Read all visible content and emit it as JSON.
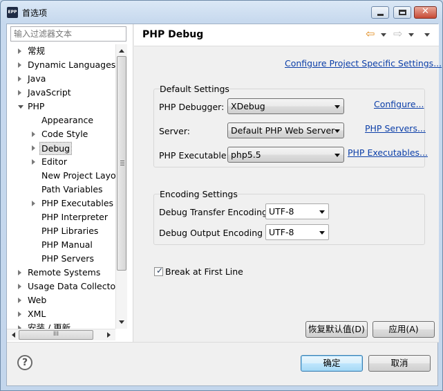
{
  "window": {
    "icon_text": "EPP",
    "title": "首选项"
  },
  "filter": {
    "placeholder": "输入过滤器文本"
  },
  "tree": [
    {
      "label": "常规",
      "level": 0,
      "twisty": "closed"
    },
    {
      "label": "Dynamic Languages",
      "level": 0,
      "twisty": "closed"
    },
    {
      "label": "Java",
      "level": 0,
      "twisty": "closed"
    },
    {
      "label": "JavaScript",
      "level": 0,
      "twisty": "closed"
    },
    {
      "label": "PHP",
      "level": 0,
      "twisty": "open"
    },
    {
      "label": "Appearance",
      "level": 1,
      "twisty": "none"
    },
    {
      "label": "Code Style",
      "level": 1,
      "twisty": "closed"
    },
    {
      "label": "Debug",
      "level": 1,
      "twisty": "closed",
      "selected": true
    },
    {
      "label": "Editor",
      "level": 1,
      "twisty": "closed"
    },
    {
      "label": "New Project Layou",
      "level": 1,
      "twisty": "none"
    },
    {
      "label": "Path Variables",
      "level": 1,
      "twisty": "none"
    },
    {
      "label": "PHP Executables",
      "level": 1,
      "twisty": "closed"
    },
    {
      "label": "PHP Interpreter",
      "level": 1,
      "twisty": "none"
    },
    {
      "label": "PHP Libraries",
      "level": 1,
      "twisty": "none"
    },
    {
      "label": "PHP Manual",
      "level": 1,
      "twisty": "none"
    },
    {
      "label": "PHP Servers",
      "level": 1,
      "twisty": "none"
    },
    {
      "label": "Remote Systems",
      "level": 0,
      "twisty": "closed"
    },
    {
      "label": "Usage Data Collector",
      "level": 0,
      "twisty": "closed"
    },
    {
      "label": "Web",
      "level": 0,
      "twisty": "closed"
    },
    {
      "label": "XML",
      "level": 0,
      "twisty": "closed"
    },
    {
      "label": "安装 / 更新",
      "level": 0,
      "twisty": "closed"
    }
  ],
  "hscroll_grip": "III",
  "page": {
    "title": "PHP Debug",
    "back_glyph": "⇦",
    "forward_glyph": "⇨",
    "project_link": "Configure Project Specific Settings...",
    "default_settings": {
      "title": "Default Settings",
      "debugger_label": "PHP Debugger:",
      "debugger_value": "XDebug",
      "debugger_link": "Configure...",
      "server_label": "Server:",
      "server_value": "Default PHP Web Server",
      "server_link": "PHP Servers...",
      "exe_label": "PHP Executable:",
      "exe_value": "php5.5",
      "exe_link": "PHP Executables..."
    },
    "encoding_settings": {
      "title": "Encoding Settings",
      "transfer_label": "Debug Transfer Encoding",
      "transfer_value": "UTF-8",
      "output_label": "Debug Output Encoding",
      "output_value": "UTF-8"
    },
    "break_first_line": {
      "label": "Break at First Line",
      "checked": true,
      "mark": "✓"
    },
    "restore_defaults": "恢复默认值(D)",
    "apply": "应用(A)"
  },
  "footer": {
    "help_glyph": "?",
    "ok": "确定",
    "cancel": "取消"
  }
}
